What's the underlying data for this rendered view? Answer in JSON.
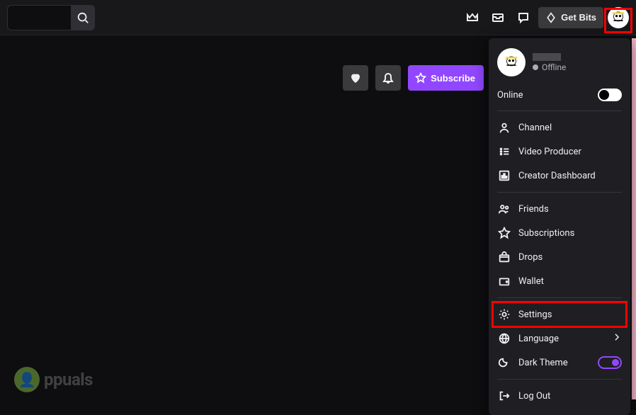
{
  "topbar": {
    "search_value": "",
    "get_bits_label": "Get Bits"
  },
  "actions": {
    "subscribe_label": "Subscribe"
  },
  "user_menu": {
    "username": "",
    "status_text": "Offline",
    "online_label": "Online",
    "online_enabled": false,
    "section1": [
      {
        "icon": "channel",
        "label": "Channel"
      },
      {
        "icon": "video-producer",
        "label": "Video Producer"
      },
      {
        "icon": "creator-dashboard",
        "label": "Creator Dashboard"
      }
    ],
    "section2": [
      {
        "icon": "friends",
        "label": "Friends"
      },
      {
        "icon": "subscriptions",
        "label": "Subscriptions"
      },
      {
        "icon": "drops",
        "label": "Drops"
      },
      {
        "icon": "wallet",
        "label": "Wallet"
      }
    ],
    "section3": [
      {
        "icon": "settings",
        "label": "Settings",
        "highlight": true
      },
      {
        "icon": "language",
        "label": "Language",
        "chevron": true
      },
      {
        "icon": "dark-theme",
        "label": "Dark Theme",
        "toggle_on": true
      }
    ],
    "logout_label": "Log Out"
  },
  "watermark": {
    "text": "ppuals"
  }
}
